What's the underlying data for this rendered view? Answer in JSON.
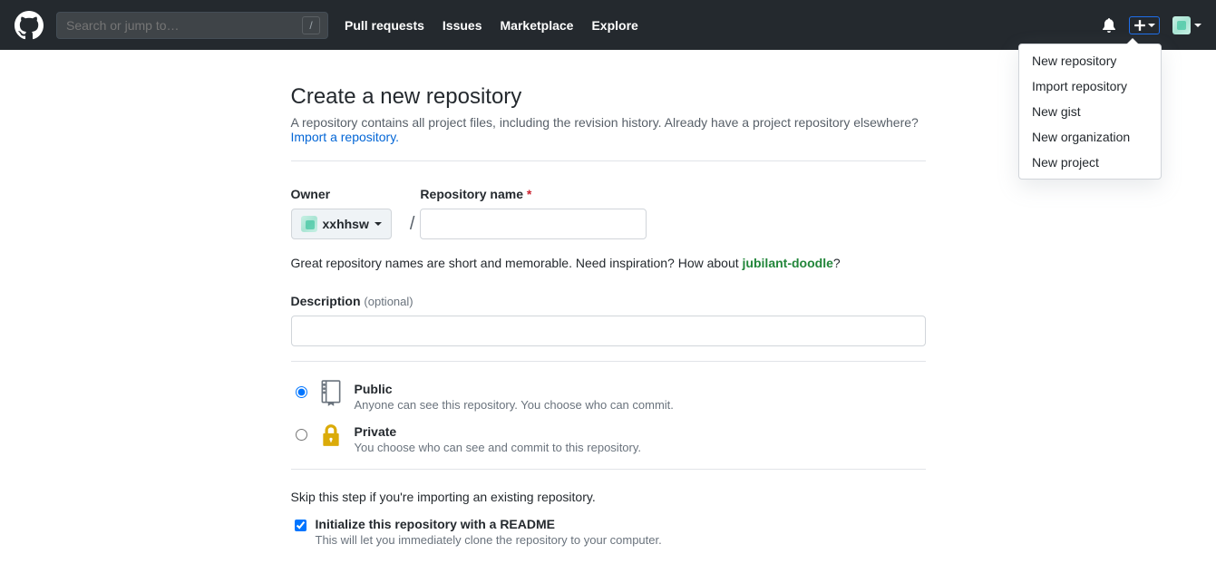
{
  "header": {
    "search_placeholder": "Search or jump to…",
    "slash": "/",
    "nav": {
      "pulls": "Pull requests",
      "issues": "Issues",
      "marketplace": "Marketplace",
      "explore": "Explore"
    }
  },
  "dropdown": {
    "items": [
      "New repository",
      "Import repository",
      "New gist",
      "New organization",
      "New project"
    ]
  },
  "page": {
    "title": "Create a new repository",
    "subhead_text": "A repository contains all project files, including the revision history. Already have a project repository elsewhere? ",
    "import_link": "Import a repository.",
    "owner_label": "Owner",
    "reponame_label": "Repository name",
    "required_marker": "*",
    "owner_value": "xxhhsw",
    "slash": "/",
    "reponame_value": "",
    "hint_pre": "Great repository names are short and memorable. Need inspiration? How about ",
    "suggestion": "jubilant-doodle",
    "hint_post": "?",
    "desc_label": "Description",
    "optional": "(optional)",
    "desc_value": "",
    "visibility": {
      "public": {
        "title": "Public",
        "desc": "Anyone can see this repository. You choose who can commit.",
        "selected": true
      },
      "private": {
        "title": "Private",
        "desc": "You choose who can see and commit to this repository.",
        "selected": false
      }
    },
    "skip_line": "Skip this step if you're importing an existing repository.",
    "init": {
      "checked": true,
      "title": "Initialize this repository with a README",
      "desc": "This will let you immediately clone the repository to your computer."
    }
  }
}
